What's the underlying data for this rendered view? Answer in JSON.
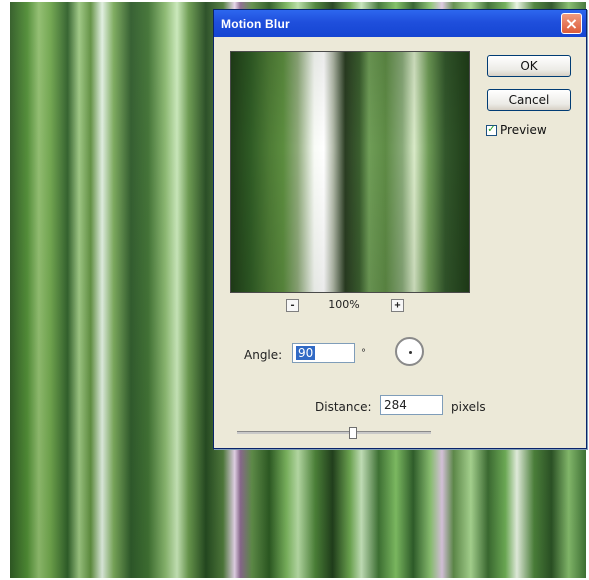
{
  "dialog": {
    "title": "Motion Blur",
    "close_icon": "close-icon",
    "ok_label": "OK",
    "cancel_label": "Cancel",
    "preview_label": "Preview",
    "preview_checked": true
  },
  "preview": {
    "zoom_value": "100%",
    "zoom_minus_label": "-",
    "zoom_plus_label": "+"
  },
  "controls": {
    "angle_label": "Angle:",
    "angle_value": "90",
    "angle_unit": "°",
    "distance_label": "Distance:",
    "distance_value": "284",
    "distance_unit": "pixels",
    "distance_slider_fraction": 0.6
  },
  "colors": {
    "title_bar": "#1f4fdc",
    "dialog_bg": "#ece9d8",
    "accent_selected": "#316ac5"
  }
}
